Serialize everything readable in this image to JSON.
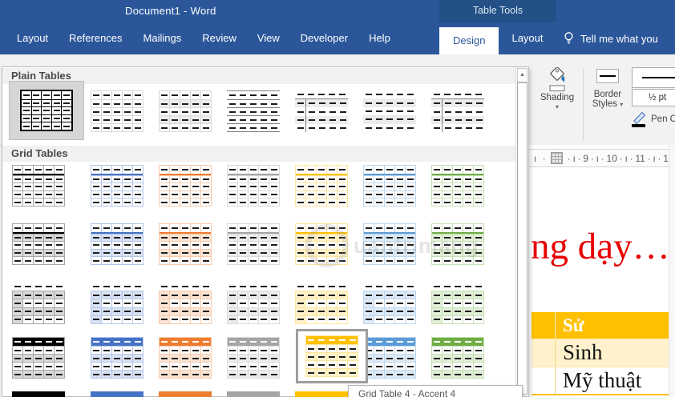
{
  "window": {
    "title": "Document1 - Word",
    "contextual_label": "Table Tools"
  },
  "tabs": {
    "main": [
      "Layout",
      "References",
      "Mailings",
      "Review",
      "View",
      "Developer",
      "Help"
    ],
    "contextual": [
      "Design",
      "Layout"
    ],
    "active_contextual": "Design",
    "tell_me": "Tell me what you"
  },
  "ribbon": {
    "shading_label": "Shading",
    "border_styles_line1": "Border",
    "border_styles_line2": "Styles",
    "dropdown_caret": "▾",
    "line_weight": "½ pt",
    "pen_color_label": "Pen Color"
  },
  "gallery": {
    "section_plain": "Plain Tables",
    "section_grid": "Grid Tables",
    "scroll_up_glyph": "▲",
    "tooltip": "Grid Table 4 - Accent 4",
    "plain_row": [
      {
        "variant": "tablegrid",
        "palette": "gray",
        "state": "selected"
      },
      {
        "variant": "plain1",
        "palette": "gray"
      },
      {
        "variant": "plain2",
        "palette": "gray"
      },
      {
        "variant": "plain3",
        "palette": "gray"
      },
      {
        "variant": "plain4",
        "palette": "gray"
      },
      {
        "variant": "plain5",
        "palette": "gray"
      },
      {
        "variant": "plain4",
        "palette": "gray"
      }
    ],
    "grid_rows": [
      {
        "variant": "light",
        "palettes": [
          "black",
          "accent1",
          "accent2",
          "accent3",
          "accent4",
          "accent5",
          "accent6"
        ]
      },
      {
        "variant": "band2",
        "palettes": [
          "black",
          "accent1",
          "accent2",
          "accent3",
          "accent4",
          "accent5",
          "accent6"
        ]
      },
      {
        "variant": "band3",
        "palettes": [
          "black",
          "accent1",
          "accent2",
          "accent3",
          "accent4",
          "accent5",
          "accent6"
        ]
      },
      {
        "variant": "header",
        "palettes": [
          "black",
          "accent1",
          "accent2",
          "accent3",
          "accent4",
          "accent5",
          "accent6"
        ],
        "hover_index": 4
      },
      {
        "variant": "dark",
        "palettes": [
          "black",
          "accent1",
          "accent2",
          "accent3",
          "accent4",
          "accent5",
          "accent6"
        ]
      }
    ]
  },
  "ruler": {
    "pre_marks": "ı ·",
    "marks": [
      "·",
      "ı",
      "·",
      "9",
      "·",
      "ı",
      "·",
      "10",
      "·",
      "ı",
      "·",
      "11",
      "·",
      "ı",
      "·",
      "1"
    ]
  },
  "document": {
    "red_text": "ng dạy…",
    "table": {
      "header": "Sử",
      "rows": [
        "Sinh",
        "Mỹ thuật"
      ]
    }
  },
  "watermark": "uantrimang",
  "colors": {
    "titlebar": "#2b579a",
    "contextual_bar": "#235086",
    "accent1": "#4472C4",
    "accent2": "#ED7D31",
    "accent3": "#A5A5A5",
    "accent4": "#FFC000",
    "accent5": "#5B9BD5",
    "accent6": "#70AD47",
    "doc_table_header": "#FFC000",
    "doc_table_band": "#FFF2CC",
    "red_text": "#e60000"
  }
}
